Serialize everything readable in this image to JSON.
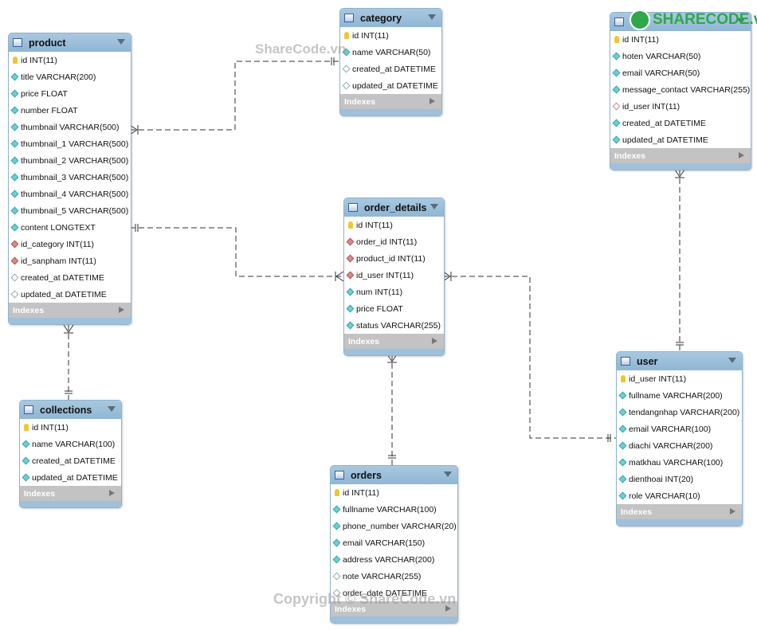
{
  "watermark_top": "ShareCode.vn",
  "watermark_bottom": "Copyright © ShareCode.vn",
  "logo": "SHARECODE.vn",
  "indexes_label": "Indexes",
  "tables": [
    {
      "key": "product",
      "name": "product",
      "pos": [
        10,
        41,
        153
      ],
      "rows": [
        {
          "icon": "pk",
          "text": "id INT(11)"
        },
        {
          "icon": "col",
          "text": "title VARCHAR(200)"
        },
        {
          "icon": "col",
          "text": "price FLOAT"
        },
        {
          "icon": "col",
          "text": "number FLOAT"
        },
        {
          "icon": "col",
          "text": "thumbnail VARCHAR(500)"
        },
        {
          "icon": "col",
          "text": "thumbnail_1 VARCHAR(500)"
        },
        {
          "icon": "col",
          "text": "thumbnail_2 VARCHAR(500)"
        },
        {
          "icon": "col",
          "text": "thumbnail_3 VARCHAR(500)"
        },
        {
          "icon": "col",
          "text": "thumbnail_4 VARCHAR(500)"
        },
        {
          "icon": "col",
          "text": "thumbnail_5 VARCHAR(500)"
        },
        {
          "icon": "col",
          "text": "content LONGTEXT"
        },
        {
          "icon": "fk",
          "text": "id_category INT(11)"
        },
        {
          "icon": "fk",
          "text": "id_sanpham INT(11)"
        },
        {
          "icon": "nul",
          "text": "created_at DATETIME"
        },
        {
          "icon": "nul",
          "text": "updated_at DATETIME"
        }
      ]
    },
    {
      "key": "category",
      "name": "category",
      "pos": [
        426,
        10,
        127
      ],
      "rows": [
        {
          "icon": "pk",
          "text": "id INT(11)"
        },
        {
          "icon": "col",
          "text": "name VARCHAR(50)"
        },
        {
          "icon": "nul",
          "text": "created_at DATETIME"
        },
        {
          "icon": "nul",
          "text": "updated_at DATETIME"
        }
      ]
    },
    {
      "key": "contact",
      "name": "",
      "pos": [
        765,
        15,
        176
      ],
      "rows": [
        {
          "icon": "pk",
          "text": "id INT(11)"
        },
        {
          "icon": "col",
          "text": "hoten VARCHAR(50)"
        },
        {
          "icon": "col",
          "text": "email VARCHAR(50)"
        },
        {
          "icon": "col",
          "text": "message_contact VARCHAR(255)"
        },
        {
          "icon": "nulfk",
          "text": "id_user INT(11)"
        },
        {
          "icon": "col",
          "text": "created_at DATETIME"
        },
        {
          "icon": "col",
          "text": "updated_at DATETIME"
        }
      ]
    },
    {
      "key": "order_details",
      "name": "order_details",
      "pos": [
        431,
        248,
        125
      ],
      "rows": [
        {
          "icon": "pk",
          "text": "id INT(11)"
        },
        {
          "icon": "fk",
          "text": "order_id INT(11)"
        },
        {
          "icon": "fk",
          "text": "product_id INT(11)"
        },
        {
          "icon": "fk",
          "text": "id_user INT(11)"
        },
        {
          "icon": "col",
          "text": "num INT(11)"
        },
        {
          "icon": "col",
          "text": "price FLOAT"
        },
        {
          "icon": "col",
          "text": "status VARCHAR(255)"
        }
      ]
    },
    {
      "key": "collections",
      "name": "collections",
      "pos": [
        24,
        502,
        127
      ],
      "rows": [
        {
          "icon": "pk",
          "text": "id INT(11)"
        },
        {
          "icon": "col",
          "text": "name VARCHAR(100)"
        },
        {
          "icon": "col",
          "text": "created_at DATETIME"
        },
        {
          "icon": "col",
          "text": "updated_at DATETIME"
        }
      ]
    },
    {
      "key": "user",
      "name": "user",
      "pos": [
        773,
        441,
        157
      ],
      "rows": [
        {
          "icon": "pk",
          "text": "id_user INT(11)"
        },
        {
          "icon": "col",
          "text": "fullname VARCHAR(200)"
        },
        {
          "icon": "col",
          "text": "tendangnhap VARCHAR(200)"
        },
        {
          "icon": "col",
          "text": "email VARCHAR(100)"
        },
        {
          "icon": "col",
          "text": "diachi VARCHAR(200)"
        },
        {
          "icon": "col",
          "text": "matkhau VARCHAR(100)"
        },
        {
          "icon": "col",
          "text": "dienthoai INT(20)"
        },
        {
          "icon": "col",
          "text": "role VARCHAR(10)"
        }
      ]
    },
    {
      "key": "orders",
      "name": "orders",
      "pos": [
        414,
        584,
        159
      ],
      "rows": [
        {
          "icon": "pk",
          "text": "id INT(11)"
        },
        {
          "icon": "col",
          "text": "fullname VARCHAR(100)"
        },
        {
          "icon": "col",
          "text": "phone_number VARCHAR(20)"
        },
        {
          "icon": "col",
          "text": "email VARCHAR(150)"
        },
        {
          "icon": "col",
          "text": "address VARCHAR(200)"
        },
        {
          "icon": "nul",
          "text": "note VARCHAR(255)"
        },
        {
          "icon": "nul",
          "text": "order_date DATETIME"
        }
      ]
    }
  ],
  "relationships": [
    {
      "from": "product",
      "to": "category",
      "many": "product"
    },
    {
      "from": "product",
      "to": "order_details",
      "many": "order_details"
    },
    {
      "from": "product",
      "to": "collections",
      "many": "product"
    },
    {
      "from": "order_details",
      "to": "user",
      "many": "order_details"
    },
    {
      "from": "order_details",
      "to": "orders",
      "many": "order_details"
    },
    {
      "from": "contact",
      "to": "user",
      "many": "contact"
    }
  ]
}
